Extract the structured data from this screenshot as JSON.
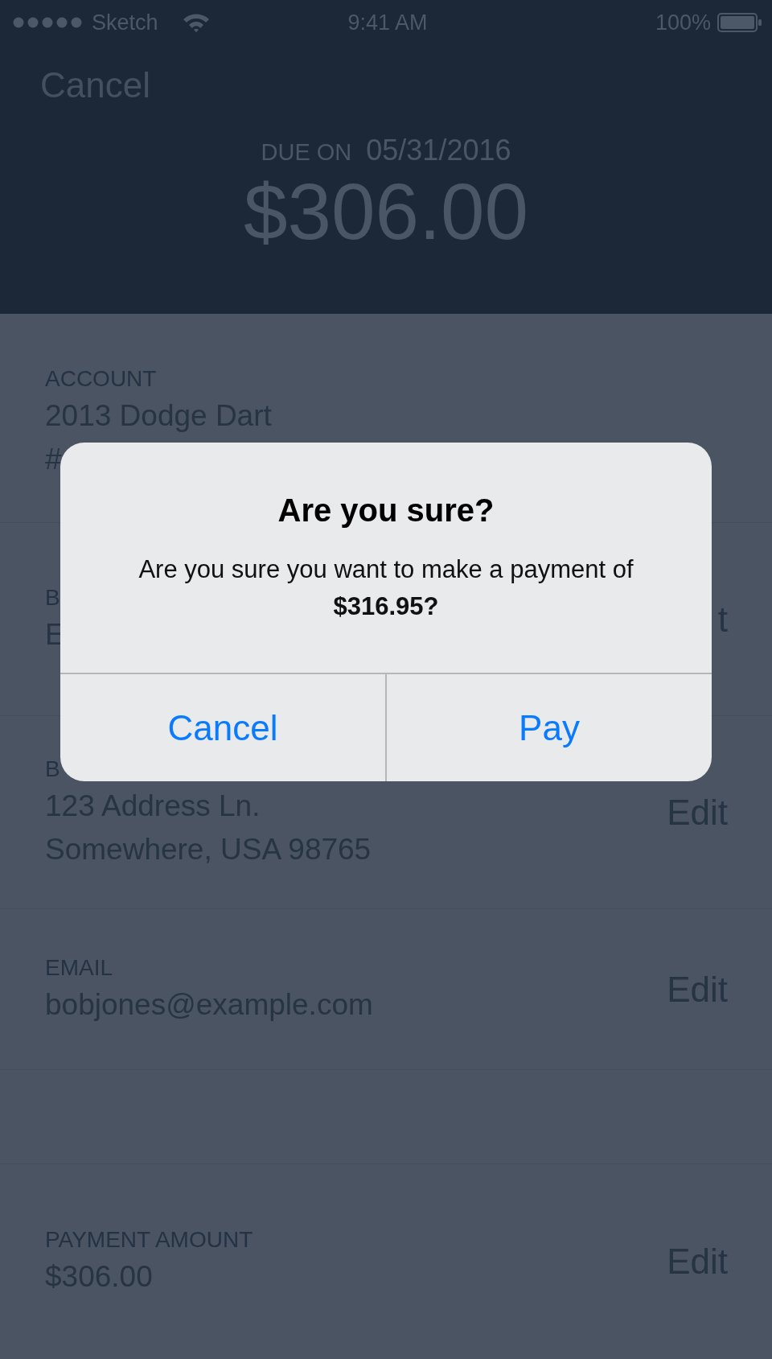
{
  "status_bar": {
    "carrier": "Sketch",
    "time": "9:41 AM",
    "battery": "100%"
  },
  "header": {
    "cancel": "Cancel",
    "due_label": "DUE ON",
    "due_date": "05/31/2016",
    "amount": "$306.00"
  },
  "sections": [
    {
      "kind": "field",
      "label": "ACCOUNT",
      "lines": [
        "2013 Dodge Dart",
        "#"
      ]
    },
    {
      "kind": "field",
      "label": "B",
      "lines": [
        "E"
      ],
      "edit": "t"
    },
    {
      "kind": "field",
      "label": "B",
      "lines": [
        "123 Address Ln.",
        "Somewhere, USA 98765"
      ],
      "edit": "Edit"
    },
    {
      "kind": "field",
      "label": "EMAIL",
      "lines": [
        "bobjones@example.com"
      ],
      "edit": "Edit"
    },
    {
      "kind": "blank"
    },
    {
      "kind": "field",
      "label": "PAYMENT AMOUNT",
      "lines": [
        "$306.00"
      ],
      "edit": "Edit"
    }
  ],
  "dialog": {
    "title": "Are you sure?",
    "message": "Are you sure you want to make a payment of **$316.95?**",
    "buttons": [
      "Cancel",
      "Pay"
    ]
  }
}
